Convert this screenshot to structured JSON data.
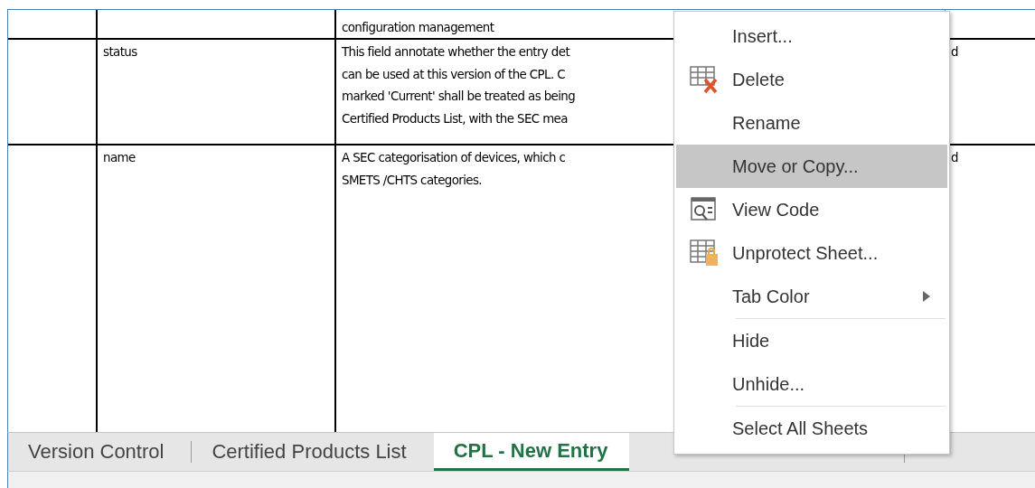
{
  "sheet": {
    "rows": [
      {
        "cells": [
          "",
          "",
          "configuration management",
          ""
        ]
      },
      {
        "cells": [
          "",
          "status",
          "This field annotate whether the entry det\ncan be used at this version of the CPL. C\nmarked 'Current' shall be treated as being\nCertified Products List, with the SEC mea",
          "d"
        ]
      },
      {
        "cells": [
          "",
          "name",
          "A SEC categorisation of devices, which c\nSMETS /CHTS categories.",
          "d"
        ]
      }
    ]
  },
  "context_menu": {
    "items": [
      {
        "kind": "item",
        "label": "Insert...",
        "selected": false,
        "submenu": false
      },
      {
        "kind": "item",
        "label": "Delete",
        "selected": false,
        "submenu": false
      },
      {
        "kind": "item",
        "label": "Rename",
        "selected": false,
        "submenu": false
      },
      {
        "kind": "item",
        "label": "Move or Copy...",
        "selected": true,
        "submenu": false
      },
      {
        "kind": "item",
        "label": "View Code",
        "selected": false,
        "submenu": false
      },
      {
        "kind": "item",
        "label": "Unprotect Sheet...",
        "selected": false,
        "submenu": false
      },
      {
        "kind": "item",
        "label": "Tab Color",
        "selected": false,
        "submenu": true
      },
      {
        "kind": "separator"
      },
      {
        "kind": "item",
        "label": "Hide",
        "selected": false,
        "submenu": false
      },
      {
        "kind": "item",
        "label": "Unhide...",
        "selected": false,
        "submenu": false
      },
      {
        "kind": "separator"
      },
      {
        "kind": "item",
        "label": "Select All Sheets",
        "selected": false,
        "submenu": false
      }
    ]
  },
  "sheet_tabs": [
    {
      "label": "Version Control",
      "selected": false
    },
    {
      "label": "Certified Products List",
      "selected": false
    },
    {
      "label": "CPL - New Entry",
      "selected": true
    },
    {
      "selected": false
    }
  ]
}
